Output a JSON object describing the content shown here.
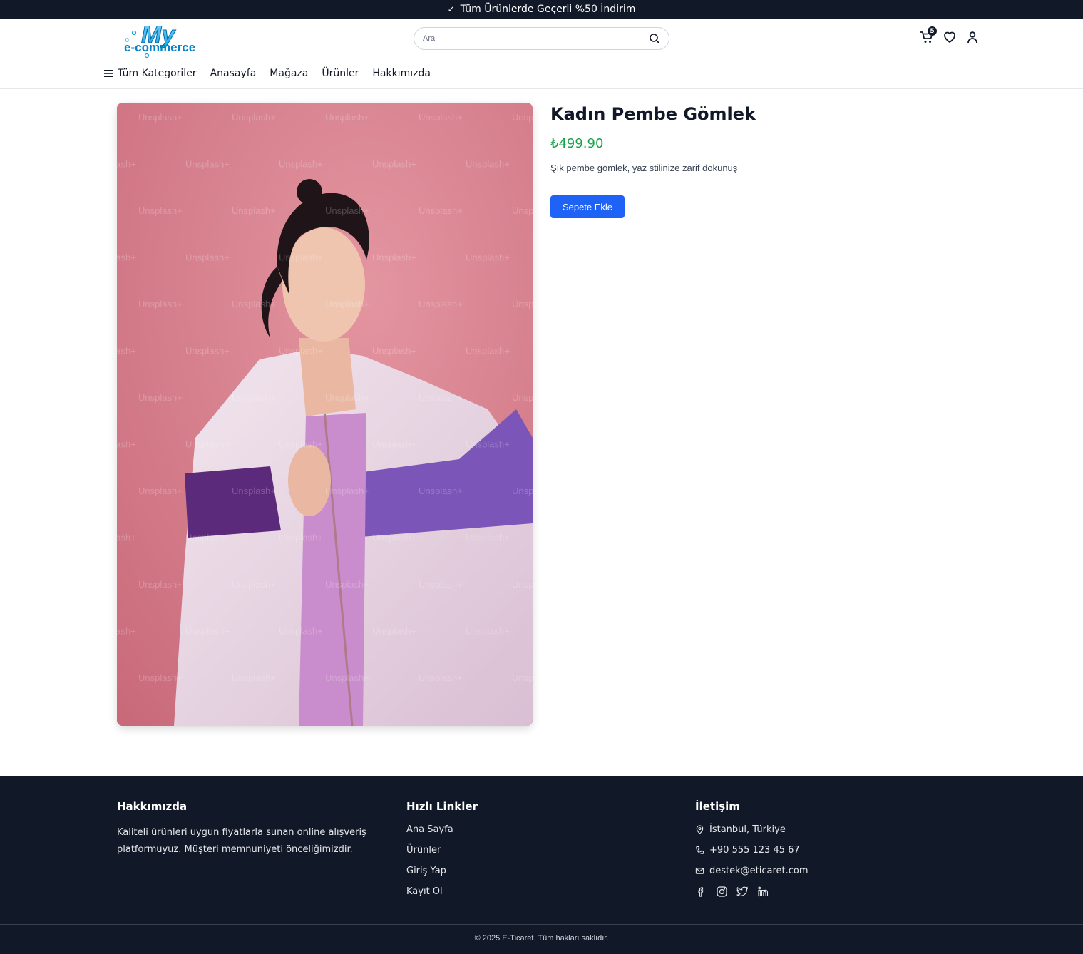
{
  "announcement": {
    "text": "Tüm Ürünlerde Geçerli %50 İndirim",
    "icon": "check-icon"
  },
  "header": {
    "logo": {
      "line1": "My",
      "line2": "e-commerce"
    },
    "search": {
      "placeholder": "Ara",
      "value": ""
    },
    "cart_count": "5",
    "icons": [
      "cart-icon",
      "heart-icon",
      "user-icon"
    ]
  },
  "nav": {
    "categories_label": "Tüm Kategoriler",
    "items": [
      "Anasayfa",
      "Mağaza",
      "Ürünler",
      "Hakkımızda"
    ]
  },
  "product": {
    "title": "Kadın Pembe Gömlek",
    "price": "₺499.90",
    "description": "Şık pembe gömlek, yaz stilinize zarif dokunuş",
    "add_to_cart": "Sepete Ekle",
    "watermark": "Unsplash+"
  },
  "footer": {
    "about": {
      "title": "Hakkımızda",
      "text": "Kaliteli ürünleri uygun fiyatlarla sunan online alışveriş platformuyuz. Müşteri memnuniyeti önceliğimizdir."
    },
    "quick_links": {
      "title": "Hızlı Linkler",
      "links": [
        "Ana Sayfa",
        "Ürünler",
        "Giriş Yap",
        "Kayıt Ol"
      ]
    },
    "contact": {
      "title": "İletişim",
      "address": "İstanbul, Türkiye",
      "phone": "+90 555 123 45 67",
      "email": "destek@eticaret.com"
    },
    "socials": [
      "facebook-icon",
      "instagram-icon",
      "twitter-icon",
      "linkedin-icon"
    ],
    "copyright": "© 2025 E-Ticaret. Tüm hakları saklıdır."
  },
  "colors": {
    "dark": "#111827",
    "accent_blue": "#1e63f5",
    "price_green": "#16a34a",
    "image_bg": "#d8808e"
  }
}
